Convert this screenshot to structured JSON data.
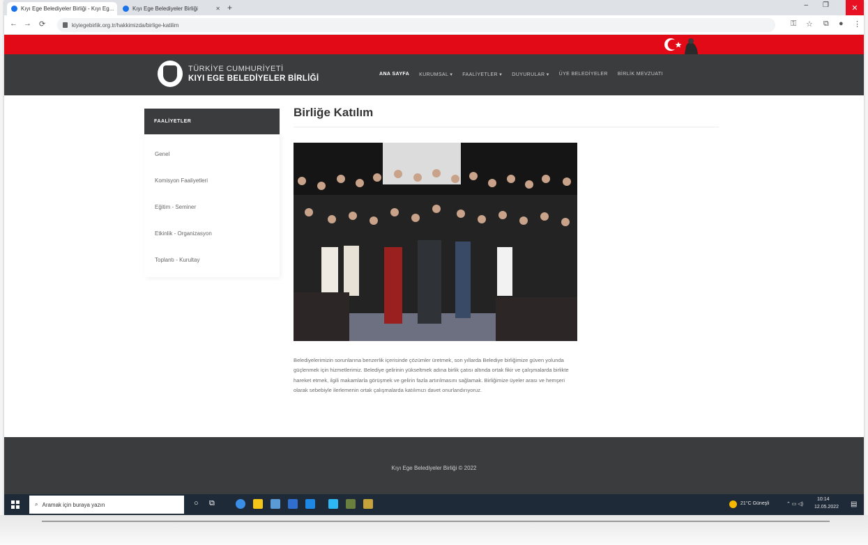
{
  "browser": {
    "tabs": [
      {
        "label": "Kıyı Ege Belediyeler Birliği - Kıyı Eg...",
        "active": true
      },
      {
        "label": "Kıyı Ege Belediyeler Birliği",
        "active": false
      }
    ],
    "new_tab_glyph": "+",
    "address": "kiyiegebirlik.org.tr/hakkimizda/birlige-katilim",
    "window_controls": {
      "minimize": "–",
      "maximize": "❐",
      "close": "✕"
    }
  },
  "site": {
    "logo": {
      "line1": "TÜRKİYE CUMHURİYETİ",
      "line2": "KIYI EGE BELEDİYELER BİRLİĞİ"
    },
    "menu": [
      "ANA SAYFA",
      "KURUMSAL ▾",
      "FAALİYETLER ▾",
      "DUYURULAR ▾",
      "ÜYE BELEDİYELER",
      "BİRLİK MEVZUATI"
    ],
    "sidebar": {
      "heading": "FAALİYETLER",
      "items": [
        "Genel",
        "Komisyon Faaliyetleri",
        "Eğitim - Seminer",
        "Etkinlik - Organizasyon",
        "Toplantı - Kurultay"
      ]
    },
    "page_title": "Birliğe Katılım",
    "body_text": "Belediyelerimizin sorunlarına benzerlik içerisinde çözümler üretmek, son yıllarda Belediye birliğimize güven yolunda güçlenmek için hizmetlerimiz. Belediye gelirinin yükseltmek adına birlik çatısı altında ortak fikir ve çalışmalarda birlikte hareket etmek, ilgili makamlarla görüşmek ve gelirin fazla artırılmasını sağlamak. Birliğimize üyeler arası ve hemşeri olarak sebebiyle ilerlemenin ortak çalışmalarda katılımızı davet onurlandırıyoruz.",
    "footer": "Kıyı Ege Belediyeler Birliği © 2022"
  },
  "taskbar": {
    "search_placeholder": "Aramak için buraya yazın",
    "weather": "21°C Güneşli",
    "time": "10:14",
    "date": "12.05.2022"
  },
  "colors": {
    "accent_red": "#e30a17",
    "nav_dark": "#3a3c3e"
  }
}
